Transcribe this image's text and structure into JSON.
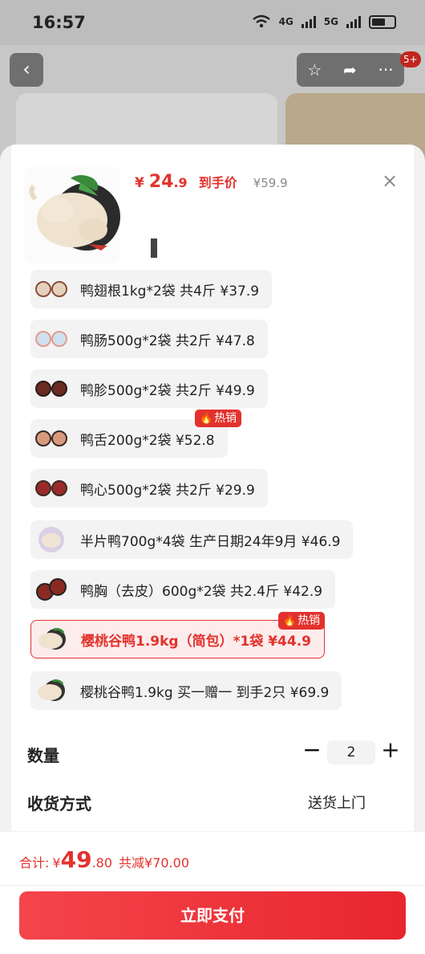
{
  "status_bar": {
    "time": "16:57",
    "net_1": "4G",
    "net_2": "5G"
  },
  "background": {
    "back_icon": "chevron-left-icon",
    "action_icons": [
      "star-icon",
      "share-icon",
      "more-icon"
    ],
    "badge": "5+"
  },
  "product": {
    "price_currency": "¥",
    "price_int": "24",
    "price_decimal": ".9",
    "price_tag": "到手价",
    "original_price": "¥59.9",
    "close_icon": "close-icon"
  },
  "options": [
    {
      "label": "鸭翅根1kg*2袋 共4斤  ¥37.9",
      "hot": false,
      "selected": false,
      "thumb": "duck-wing-thumb"
    },
    {
      "label": "鸭肠500g*2袋 共2斤  ¥47.8",
      "hot": false,
      "selected": false,
      "thumb": "duck-intestine-thumb"
    },
    {
      "label": "鸭胗500g*2袋 共2斤  ¥49.9",
      "hot": false,
      "selected": false,
      "thumb": "duck-gizzard-thumb"
    },
    {
      "label": "鸭舌200g*2袋  ¥52.8",
      "hot": true,
      "selected": false,
      "thumb": "duck-tongue-thumb"
    },
    {
      "label": "鸭心500g*2袋 共2斤  ¥29.9",
      "hot": false,
      "selected": false,
      "thumb": "duck-heart-thumb"
    },
    {
      "label": "半片鸭700g*4袋 生产日期24年9月  ¥46.9",
      "hot": false,
      "selected": false,
      "thumb": "half-duck-thumb"
    },
    {
      "label": "鸭胸（去皮）600g*2袋 共2.4斤  ¥42.9",
      "hot": false,
      "selected": false,
      "thumb": "duck-breast-thumb"
    },
    {
      "label": "樱桃谷鸭1.9kg（简包）*1袋  ¥44.9",
      "hot": true,
      "selected": true,
      "thumb": "whole-duck-thumb"
    },
    {
      "label": "樱桃谷鸭1.9kg 买一赠一 到手2只  ¥69.9",
      "hot": false,
      "selected": false,
      "thumb": "whole-duck-thumb"
    }
  ],
  "hot_badge_label": "热销",
  "quantity": {
    "label": "数量",
    "value": "2",
    "minus": "−",
    "plus": "+"
  },
  "shipping": {
    "label": "收货方式",
    "value": "送货上门"
  },
  "footer": {
    "total_label": "合计:",
    "total_currency": "¥",
    "total_int": "49",
    "total_decimal": ".80",
    "saved": "共减¥70.00",
    "pay_button": "立即支付"
  },
  "colors": {
    "accent": "#e3322d",
    "button": "#ef3a40"
  }
}
